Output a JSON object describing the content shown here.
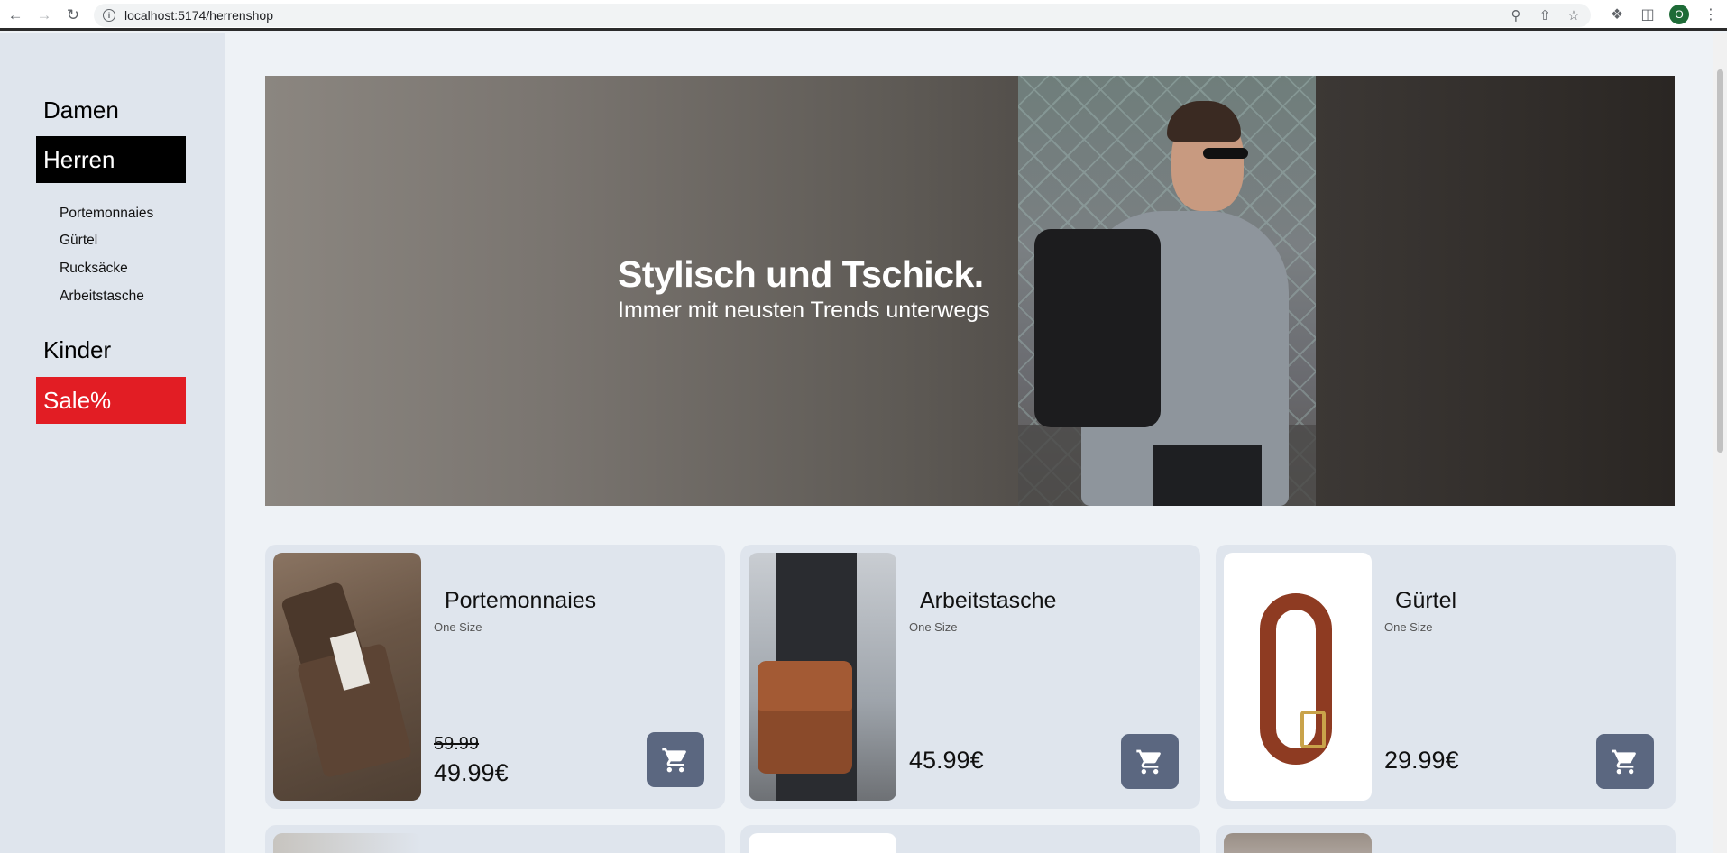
{
  "browser": {
    "url": "localhost:5174/herrenshop",
    "profile_initial": "O"
  },
  "sidebar": {
    "categories": [
      {
        "label": "Damen"
      },
      {
        "label": "Herren"
      },
      {
        "label": "Kinder"
      },
      {
        "label": "Sale%"
      }
    ],
    "subcategories": [
      {
        "label": "Portemonnaies"
      },
      {
        "label": "Gürtel"
      },
      {
        "label": "Rucksäcke"
      },
      {
        "label": "Arbeitstasche"
      }
    ]
  },
  "hero": {
    "title": "Stylisch und Tschick.",
    "subtitle": "Immer mit neusten Trends unterwegs"
  },
  "products": [
    {
      "name": "Portemonnaies",
      "size": "One Size",
      "old_price": "59.99",
      "price": "49.99€"
    },
    {
      "name": "Arbeitstasche",
      "size": "One Size",
      "price": "45.99€"
    },
    {
      "name": "Gürtel",
      "size": "One Size",
      "price": "29.99€"
    }
  ],
  "colors": {
    "active_category": "#000000",
    "sale": "#e21d24",
    "cart_button": "#5b6780",
    "sidebar_bg": "#dfe5ed",
    "page_bg": "#eef2f6"
  }
}
